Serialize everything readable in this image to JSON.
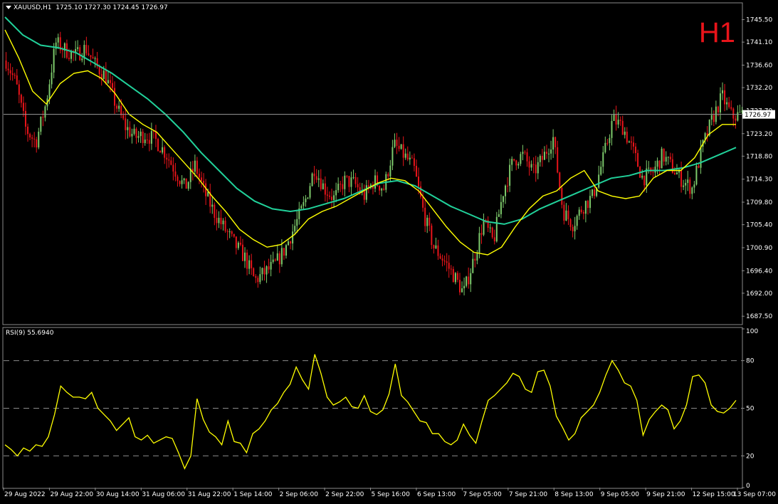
{
  "header": {
    "symbol": "XAUUSD,H1",
    "open": "1725.10",
    "high": "1727.30",
    "low": "1724.45",
    "close": "1726.97",
    "timeframe_badge": "H1"
  },
  "rsi_header": {
    "label": "RSI(9) 55.6940"
  },
  "colors": {
    "background": "#000000",
    "bull": "#7dc96b",
    "bear": "#e8141a",
    "ma_fast": "#ffff00",
    "ma_slow": "#21d19a",
    "rsi": "#ffff00",
    "grid": "#5a5a5a",
    "price_line": "#9a9a9a"
  },
  "chart_data": [
    {
      "type": "candlestick",
      "title": "XAUUSD,H1",
      "current_price": 1726.97,
      "current_price_label": "1726.97",
      "ylim": [
        1686.0,
        1748.5
      ],
      "y_ticks": [
        "1745.50",
        "1741.10",
        "1736.60",
        "1732.20",
        "1727.70",
        "1723.20",
        "1718.80",
        "1714.30",
        "1709.80",
        "1705.40",
        "1700.90",
        "1696.40",
        "1692.00",
        "1687.50"
      ],
      "y_tick_values": [
        1745.5,
        1741.1,
        1736.6,
        1732.2,
        1727.7,
        1723.2,
        1718.8,
        1714.3,
        1709.8,
        1705.4,
        1700.9,
        1696.4,
        1692.0,
        1687.5
      ],
      "x_labels": [
        "29 Aug 2022",
        "29 Aug 22:00",
        "30 Aug 14:00",
        "31 Aug 06:00",
        "31 Aug 22:00",
        "1 Sep 14:00",
        "2 Sep 06:00",
        "2 Sep 22:00",
        "5 Sep 16:00",
        "6 Sep 13:00",
        "7 Sep 05:00",
        "7 Sep 21:00",
        "8 Sep 13:00",
        "9 Sep 05:00",
        "9 Sep 21:00",
        "12 Sep 15:00",
        "13 Sep 07:00"
      ],
      "close_path": [
        1737.5,
        1733.0,
        1724.0,
        1721.5,
        1729.0,
        1741.0,
        1739.5,
        1738.5,
        1740.0,
        1736.5,
        1734.5,
        1729.0,
        1724.5,
        1722.5,
        1723.0,
        1722.0,
        1719.5,
        1716.0,
        1712.5,
        1717.0,
        1711.5,
        1707.5,
        1704.5,
        1701.5,
        1699.0,
        1694.5,
        1696.0,
        1697.5,
        1700.5,
        1705.0,
        1709.5,
        1716.5,
        1712.5,
        1710.5,
        1714.0,
        1713.5,
        1711.0,
        1714.0,
        1712.5,
        1721.0,
        1719.0,
        1716.5,
        1707.5,
        1701.0,
        1698.5,
        1695.5,
        1692.0,
        1698.5,
        1706.0,
        1702.0,
        1712.0,
        1718.0,
        1719.0,
        1715.5,
        1718.5,
        1722.5,
        1708.0,
        1705.5,
        1709.0,
        1711.0,
        1718.0,
        1726.0,
        1724.5,
        1720.0,
        1714.5,
        1715.5,
        1719.0,
        1716.5,
        1714.0,
        1712.5,
        1720.5,
        1726.0,
        1730.5,
        1726.5,
        1726.97
      ],
      "ma_fast_path": [
        1743.5,
        1738.0,
        1731.5,
        1729.0,
        1733.0,
        1735.0,
        1735.5,
        1734.0,
        1731.0,
        1727.0,
        1725.0,
        1723.5,
        1720.5,
        1717.5,
        1714.5,
        1711.0,
        1708.0,
        1704.5,
        1702.5,
        1701.0,
        1701.5,
        1703.5,
        1706.5,
        1708.0,
        1709.0,
        1710.5,
        1712.0,
        1713.5,
        1714.5,
        1714.0,
        1712.0,
        1708.5,
        1705.0,
        1702.0,
        1700.0,
        1699.5,
        1701.0,
        1705.0,
        1708.5,
        1711.0,
        1712.0,
        1714.5,
        1716.0,
        1712.0,
        1711.0,
        1710.5,
        1711.0,
        1714.5,
        1716.0,
        1716.0,
        1718.5,
        1723.0,
        1725.0,
        1725.0
      ],
      "ma_slow_path": [
        1746.0,
        1742.5,
        1740.5,
        1740.0,
        1739.0,
        1737.0,
        1735.0,
        1732.5,
        1730.0,
        1727.0,
        1723.5,
        1719.5,
        1716.0,
        1712.5,
        1710.0,
        1708.5,
        1708.0,
        1708.5,
        1709.5,
        1710.5,
        1712.0,
        1713.5,
        1714.0,
        1713.0,
        1711.0,
        1709.0,
        1707.5,
        1706.0,
        1705.5,
        1706.5,
        1708.5,
        1710.0,
        1711.5,
        1713.0,
        1714.5,
        1715.0,
        1716.0,
        1716.0,
        1716.5,
        1717.5,
        1719.0,
        1720.5
      ]
    },
    {
      "type": "line",
      "title": "RSI(9) 55.6940",
      "ylim": [
        0,
        100
      ],
      "y_ticks": [
        "100",
        "80",
        "50",
        "20",
        "0"
      ],
      "y_tick_values": [
        100,
        80,
        50,
        20,
        0
      ],
      "levels": [
        80,
        50,
        20
      ],
      "series": [
        {
          "values": [
            27,
            24,
            20,
            25,
            23,
            27,
            26,
            32,
            46,
            64,
            60,
            57,
            57,
            56,
            60,
            50,
            46,
            42,
            36,
            40,
            44,
            32,
            30,
            33,
            28,
            30,
            32,
            31,
            22,
            12,
            20,
            56,
            43,
            35,
            32,
            27,
            42,
            29,
            28,
            22,
            34,
            37,
            42,
            49,
            53,
            60,
            65,
            76,
            68,
            62,
            84,
            72,
            57,
            52,
            54,
            57,
            51,
            50,
            58,
            48,
            46,
            49,
            59,
            78,
            58,
            54,
            48,
            42,
            41,
            34,
            34,
            29,
            27,
            30,
            40,
            33,
            28,
            42,
            55,
            58,
            62,
            66,
            72,
            70,
            62,
            60,
            73,
            74,
            64,
            45,
            38,
            30,
            34,
            44,
            48,
            52,
            60,
            71,
            80,
            74,
            66,
            64,
            55,
            33,
            43,
            48,
            52,
            49,
            37,
            42,
            52,
            70,
            71,
            66,
            52,
            48,
            47,
            50,
            55
          ]
        }
      ]
    }
  ]
}
